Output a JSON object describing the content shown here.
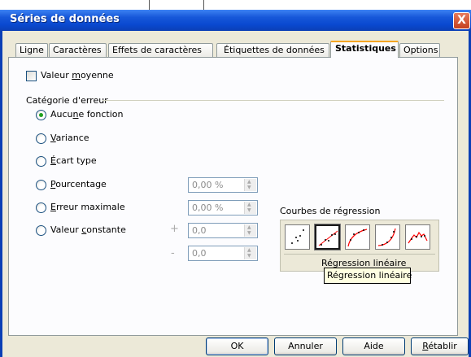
{
  "window": {
    "title": "Séries de données",
    "close_glyph": "X"
  },
  "tabs": [
    {
      "label": "Ligne",
      "active": false
    },
    {
      "label": "Caractères",
      "active": false
    },
    {
      "label": "Effets de caractères",
      "active": false
    },
    {
      "label": "Étiquettes de données",
      "active": false
    },
    {
      "label": "Statistiques",
      "active": true
    },
    {
      "label": "Options",
      "active": false
    }
  ],
  "mean": {
    "label_pre": "Valeur ",
    "label_u": "m",
    "label_post": "oyenne",
    "checked": false
  },
  "error_category": {
    "heading": "Catégorie d'erreur",
    "options": [
      {
        "pre": "Aucu",
        "u": "n",
        "post": "e fonction",
        "selected": true
      },
      {
        "pre": "",
        "u": "V",
        "post": "ariance",
        "selected": false
      },
      {
        "pre": "",
        "u": "É",
        "post": "cart type",
        "selected": false
      },
      {
        "pre": "",
        "u": "P",
        "post": "ourcentage",
        "selected": false
      },
      {
        "pre": "",
        "u": "E",
        "post": "rreur maximale",
        "selected": false
      },
      {
        "pre": "Valeur ",
        "u": "c",
        "post": "onstante",
        "selected": false
      }
    ],
    "fields": {
      "percentage": "0,00 %",
      "max_error": "0,00 %",
      "const_plus": "0,0",
      "const_minus": "0,0",
      "plus_sign": "+",
      "minus_sign": "-"
    }
  },
  "regression": {
    "heading": "Courbes de régression",
    "selected_label": "Régression linéaire",
    "tooltip": "Régression linéaire",
    "curves": [
      "aucune",
      "lineaire",
      "logarithmique",
      "exponentielle",
      "puissance"
    ]
  },
  "buttons": {
    "ok": "OK",
    "cancel": "Annuler",
    "help": "Aide",
    "reset_u": "R",
    "reset_post": "établir"
  },
  "colors": {
    "title_bar": "#0b49d0",
    "dialog_bg": "#ece9d8",
    "active_tab_accent": "#f5a623",
    "radio_dot": "#21a121",
    "curve": "#ff0000"
  }
}
